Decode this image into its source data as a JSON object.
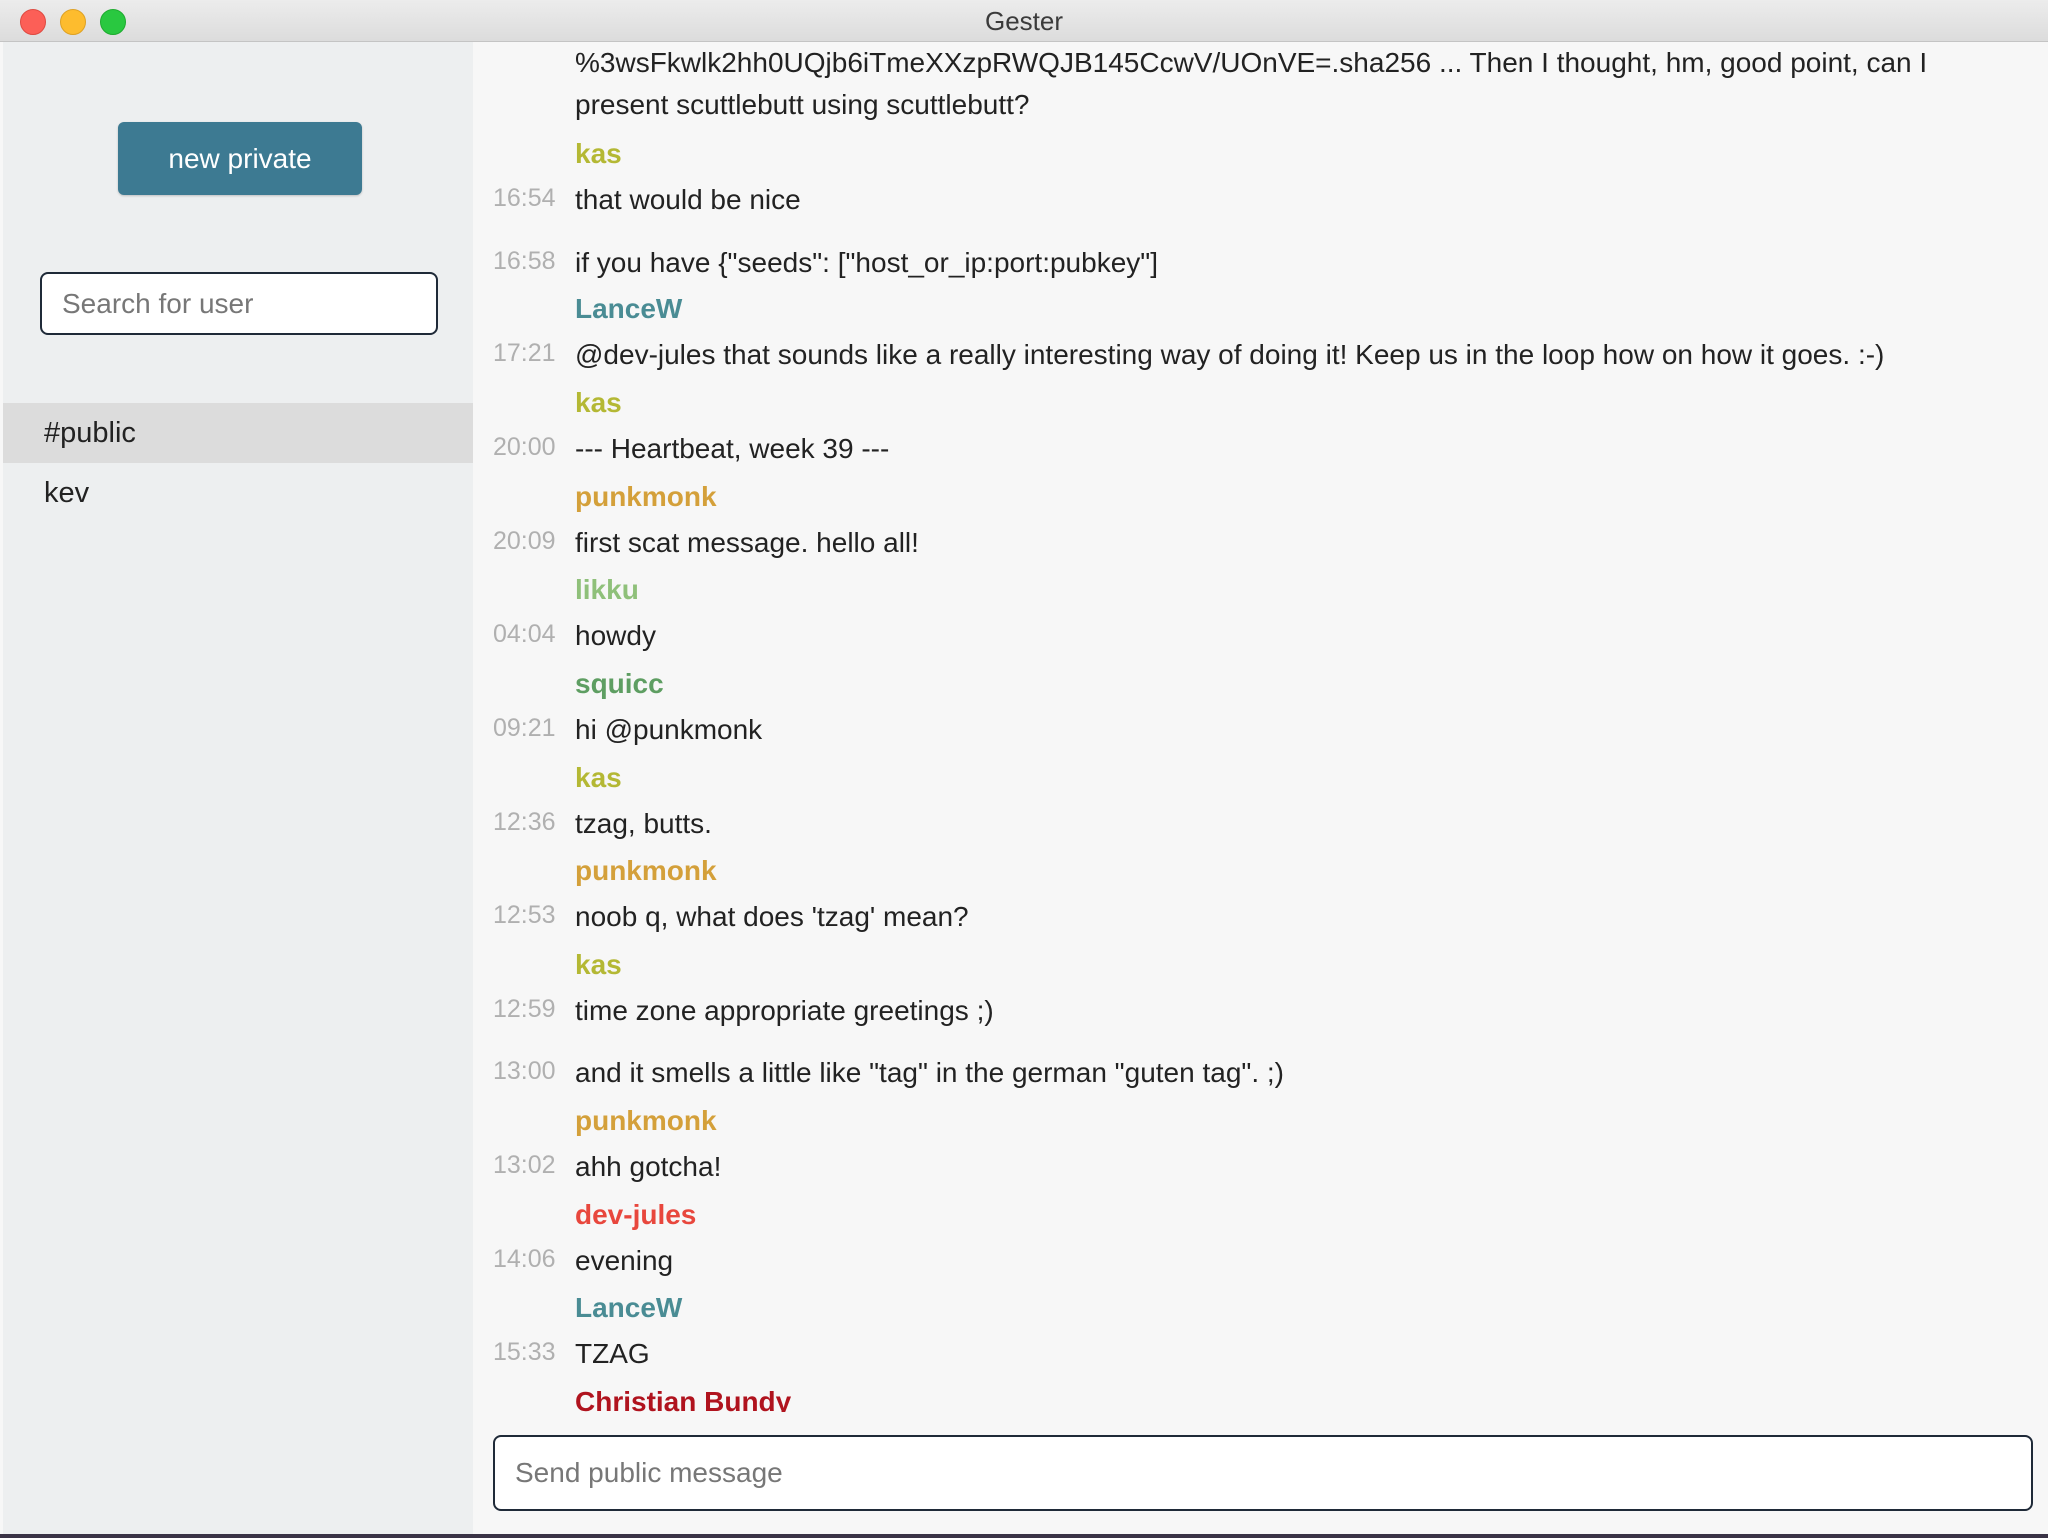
{
  "window": {
    "title": "Gester"
  },
  "sidebar": {
    "new_private_label": "new private",
    "search_placeholder": "Search for user",
    "channels": [
      {
        "label": "#public",
        "active": true
      },
      {
        "label": "kev",
        "active": false
      }
    ]
  },
  "messages": [
    {
      "author": "",
      "author_color": "",
      "time": "",
      "text": "%3wsFkwlk2hh0UQjb6iTmeXXzpRWQJB145CcwV/UOnVE=.sha256 ... Then I thought, hm, good point, can I present scuttlebutt using scuttlebutt?"
    },
    {
      "author": "kas",
      "author_color": "#b4b834",
      "time": "16:54",
      "text": "that would be nice"
    },
    {
      "author": "",
      "author_color": "",
      "time": "16:58",
      "text": "if you have {\"seeds\": [\"host_or_ip:port:pubkey\"]"
    },
    {
      "author": "LanceW",
      "author_color": "#4a8c94",
      "time": "17:21",
      "text": "@dev-jules that sounds like a really interesting way of doing it! Keep us in the loop how on how it goes. :-)"
    },
    {
      "author": "kas",
      "author_color": "#b4b834",
      "time": "20:00",
      "text": "--- Heartbeat, week 39 ---"
    },
    {
      "author": "punkmonk",
      "author_color": "#d4a03a",
      "time": "20:09",
      "text": "first scat message. hello all!"
    },
    {
      "author": "likku",
      "author_color": "#8fc07a",
      "time": "04:04",
      "text": "howdy"
    },
    {
      "author": "squicc",
      "author_color": "#5e9e62",
      "time": "09:21",
      "text": "hi @punkmonk"
    },
    {
      "author": "kas",
      "author_color": "#b4b834",
      "time": "12:36",
      "text": "tzag, butts."
    },
    {
      "author": "punkmonk",
      "author_color": "#d4a03a",
      "time": "12:53",
      "text": "noob q, what does 'tzag' mean?"
    },
    {
      "author": "kas",
      "author_color": "#b4b834",
      "time": "12:59",
      "text": "time zone appropriate greetings ;)"
    },
    {
      "author": "",
      "author_color": "",
      "time": "13:00",
      "text": "and it smells a little like \"tag\" in the german \"guten tag\". ;)"
    },
    {
      "author": "punkmonk",
      "author_color": "#d4a03a",
      "time": "13:02",
      "text": "ahh gotcha!"
    },
    {
      "author": "dev-jules",
      "author_color": "#e8473d",
      "time": "14:06",
      "text": "evening"
    },
    {
      "author": "LanceW",
      "author_color": "#4a8c94",
      "time": "15:33",
      "text": "TZAG"
    },
    {
      "author": "Christian Bundy",
      "author_color": "#b0131e",
      "time": "",
      "text": ""
    }
  ],
  "composer": {
    "placeholder": "Send public message"
  }
}
